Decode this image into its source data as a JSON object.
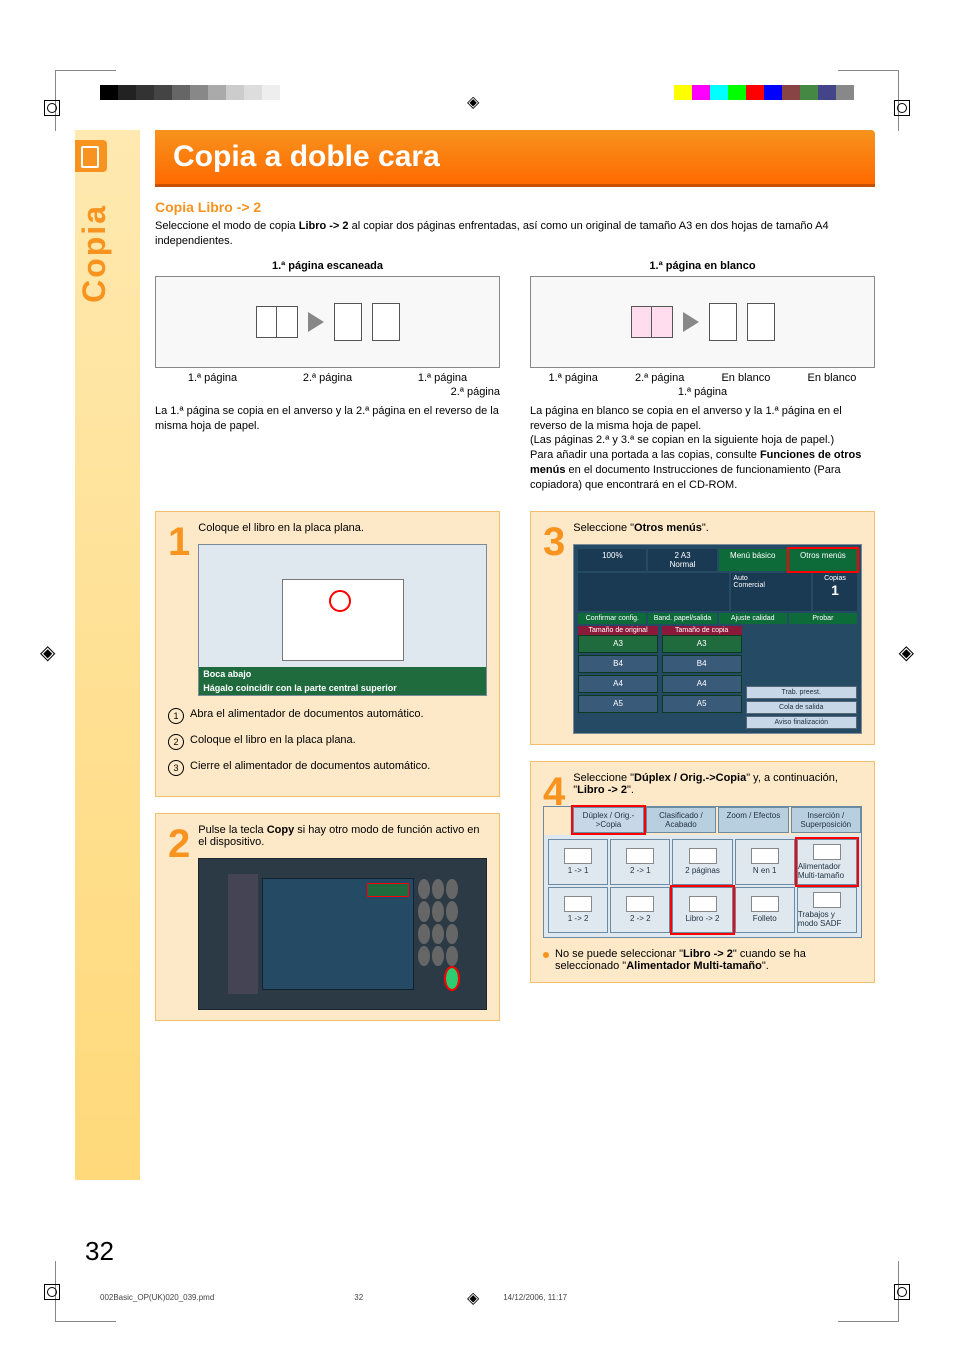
{
  "tab_label": "Copia",
  "title": "Copia a doble cara",
  "subtitle": "Copia Libro -> 2",
  "intro_a": "Seleccione el modo de copia ",
  "intro_bold": "Libro -> 2",
  "intro_b": " al copiar dos páginas enfrentadas, así como un original de tamaño A3 en dos hojas de tamaño A4 independientes.",
  "diag_left": {
    "head": "1.ª página escaneada",
    "labels": [
      "1.ª página",
      "2.ª página",
      "1.ª página",
      "2.ª página"
    ],
    "caption": "La 1.ª página se copia en el anverso y la 2.ª página en el reverso de la misma hoja de papel."
  },
  "diag_right": {
    "head": "1.ª página en blanco",
    "labels": [
      "1.ª página",
      "2.ª página",
      "En blanco",
      "1.ª página",
      "En blanco"
    ],
    "cap_a": "La página en blanco se copia en el anverso y la 1.ª página en el reverso de la misma hoja de papel.",
    "cap_b": "(Las páginas 2.ª y 3.ª se copian en la siguiente hoja de papel.)",
    "cap_c": "Para añadir una portada a las copias, consulte ",
    "cap_c_bold": "Funciones de otros menús",
    "cap_c2": " en el documento Instrucciones de funcionamiento (Para copiadora) que encontrará en el CD-ROM."
  },
  "step1": {
    "num": "1",
    "text": "Coloque el libro en la placa plana.",
    "overlay_a": "Boca abajo",
    "overlay_b": "Hágalo coincidir con la parte central superior",
    "sub1": "Abra el alimentador de documentos automático.",
    "sub2": "Coloque el libro en la placa plana.",
    "sub3": "Cierre el alimentador de documentos automático."
  },
  "step2": {
    "num": "2",
    "text_a": "Pulse la tecla ",
    "text_bold": "Copy",
    "text_b": " si hay otro modo de función activo en el dispositivo."
  },
  "step3": {
    "num": "3",
    "text_a": "Seleccione \"",
    "text_bold": "Otros menús",
    "text_b": "\".",
    "screen_top": [
      "100%",
      "2 A3",
      "Normal",
      "Menú básico",
      "Otros menús"
    ],
    "screen_labels": [
      "Auto",
      "Comercial",
      "Copias",
      "1",
      "Confirmar config.",
      "Band. papel/salida",
      "Ajuste calidad",
      "Probar"
    ],
    "left": [
      "Tamaño de original",
      "A3",
      "B4",
      "A4",
      "A5"
    ],
    "right": [
      "Tamaño de copia",
      "A3",
      "B4",
      "A4",
      "A5"
    ],
    "side": [
      "Trab. preest.",
      "Cola de salida",
      "Aviso finalización"
    ]
  },
  "step4": {
    "num": "4",
    "text_a": "Seleccione \"",
    "bold1": "Dúplex / Orig.->Copia",
    "mid": "\" y, a continuación, \"",
    "bold2": "Libro -> 2",
    "text_b": "\".",
    "tabs": [
      "Dúplex / Orig.->Copia",
      "Clasificado / Acabado",
      "Zoom / Efectos",
      "Inserción / Superposición"
    ],
    "btns1": [
      "1 -> 1",
      "2 -> 1",
      "2 páginas",
      "N en 1",
      "Alimentador Multi-tamaño"
    ],
    "btns2": [
      "1 -> 2",
      "2 -> 2",
      "Libro -> 2",
      "Folleto",
      "Trabajos y modo SADF"
    ],
    "bullet_a": "No se puede seleccionar \"",
    "bullet_b1": "Libro -> 2",
    "bullet_mid": "\" cuando se ha seleccionado \"",
    "bullet_b2": "Alimentador Multi-tamaño",
    "bullet_end": "\"."
  },
  "page_number": "32",
  "footer": {
    "file": "002Basic_OP(UK)020_039.pmd",
    "page": "32",
    "date": "14/12/2006, 11:17"
  }
}
